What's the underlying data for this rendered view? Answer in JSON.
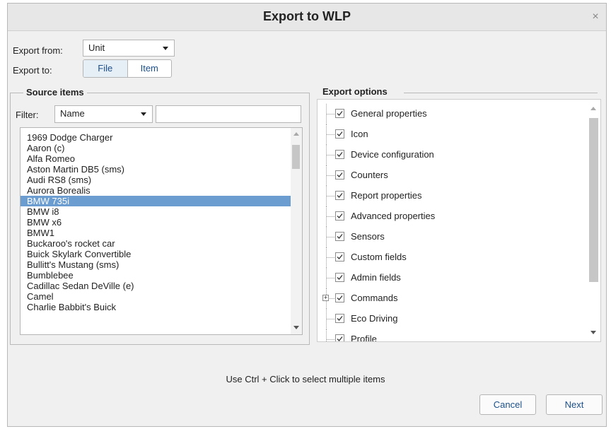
{
  "dialog": {
    "title": "Export to WLP",
    "close": "×"
  },
  "export_from": {
    "label": "Export from:",
    "value": "Unit"
  },
  "export_to": {
    "label": "Export to:",
    "options": [
      "File",
      "Item"
    ],
    "active": "File"
  },
  "source": {
    "title": "Source items",
    "filter_label": "Filter:",
    "filter_value": "Name",
    "search_value": "",
    "items": [
      "1969 Dodge Charger",
      "Aaron (c)",
      "Alfa Romeo",
      "Aston Martin DB5 (sms)",
      "Audi RS8 (sms)",
      "Aurora Borealis",
      "BMW 735i",
      "BMW i8",
      "BMW x6",
      "BMW1",
      "Buckaroo's rocket car",
      "Buick Skylark Convertible",
      "Bullitt's Mustang (sms)",
      "Bumblebee",
      "Cadillac Sedan DeVille (e)",
      "Camel",
      "Charlie Babbit's Buick"
    ],
    "selected_index": 6
  },
  "options": {
    "title": "Export options",
    "items": [
      {
        "label": "General properties",
        "checked": true,
        "expandable": false
      },
      {
        "label": "Icon",
        "checked": true,
        "expandable": false
      },
      {
        "label": "Device configuration",
        "checked": true,
        "expandable": false
      },
      {
        "label": "Counters",
        "checked": true,
        "expandable": false
      },
      {
        "label": "Report properties",
        "checked": true,
        "expandable": false
      },
      {
        "label": "Advanced properties",
        "checked": true,
        "expandable": false
      },
      {
        "label": "Sensors",
        "checked": true,
        "expandable": false
      },
      {
        "label": "Custom fields",
        "checked": true,
        "expandable": false
      },
      {
        "label": "Admin fields",
        "checked": true,
        "expandable": false
      },
      {
        "label": "Commands",
        "checked": true,
        "expandable": true
      },
      {
        "label": "Eco Driving",
        "checked": true,
        "expandable": false
      },
      {
        "label": "Profile",
        "checked": true,
        "expandable": false
      }
    ]
  },
  "hint": "Use Ctrl + Click to select multiple items",
  "buttons": {
    "cancel": "Cancel",
    "next": "Next"
  },
  "colors": {
    "selection": "#6b9dd1",
    "link_text": "#1c4f8a"
  }
}
